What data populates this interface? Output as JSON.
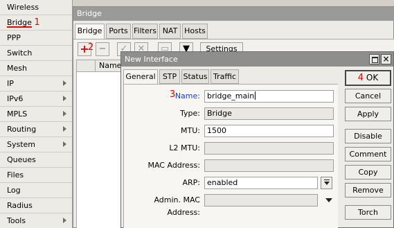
{
  "sidebar": {
    "items": [
      {
        "label": "Wireless",
        "arrow": false
      },
      {
        "label": "Bridge",
        "arrow": false,
        "marker": "1"
      },
      {
        "label": "PPP",
        "arrow": false
      },
      {
        "label": "Switch",
        "arrow": false
      },
      {
        "label": "Mesh",
        "arrow": false
      },
      {
        "label": "IP",
        "arrow": true
      },
      {
        "label": "IPv6",
        "arrow": true
      },
      {
        "label": "MPLS",
        "arrow": true
      },
      {
        "label": "Routing",
        "arrow": true
      },
      {
        "label": "System",
        "arrow": true
      },
      {
        "label": "Queues",
        "arrow": false
      },
      {
        "label": "Files",
        "arrow": false
      },
      {
        "label": "Log",
        "arrow": false
      },
      {
        "label": "Radius",
        "arrow": false
      },
      {
        "label": "Tools",
        "arrow": true
      }
    ]
  },
  "bridge_window": {
    "title": "Bridge",
    "tabs": [
      "Bridge",
      "Ports",
      "Filters",
      "NAT",
      "Hosts"
    ],
    "add_marker": "2",
    "settings_label": "Settings",
    "table_header": "Name"
  },
  "dialog": {
    "title": "New Interface",
    "tabs": [
      "General",
      "STP",
      "Status",
      "Traffic"
    ],
    "name_marker": "3",
    "ok_marker": "4",
    "fields": {
      "name": {
        "label": "Name:",
        "value": "bridge_main"
      },
      "type": {
        "label": "Type:",
        "value": "Bridge"
      },
      "mtu": {
        "label": "MTU:",
        "value": "1500"
      },
      "l2mtu": {
        "label": "L2 MTU:",
        "value": ""
      },
      "mac": {
        "label": "MAC Address:",
        "value": ""
      },
      "arp": {
        "label": "ARP:",
        "value": "enabled"
      },
      "admin_mac": {
        "label": "Admin. MAC Address:",
        "value": ""
      }
    },
    "buttons": {
      "ok": "OK",
      "cancel": "Cancel",
      "apply": "Apply",
      "disable": "Disable",
      "comment": "Comment",
      "copy": "Copy",
      "remove": "Remove",
      "torch": "Torch"
    }
  },
  "colors": {
    "annotation_red": "#e00000",
    "name_label_blue": "#1a3cd0"
  }
}
